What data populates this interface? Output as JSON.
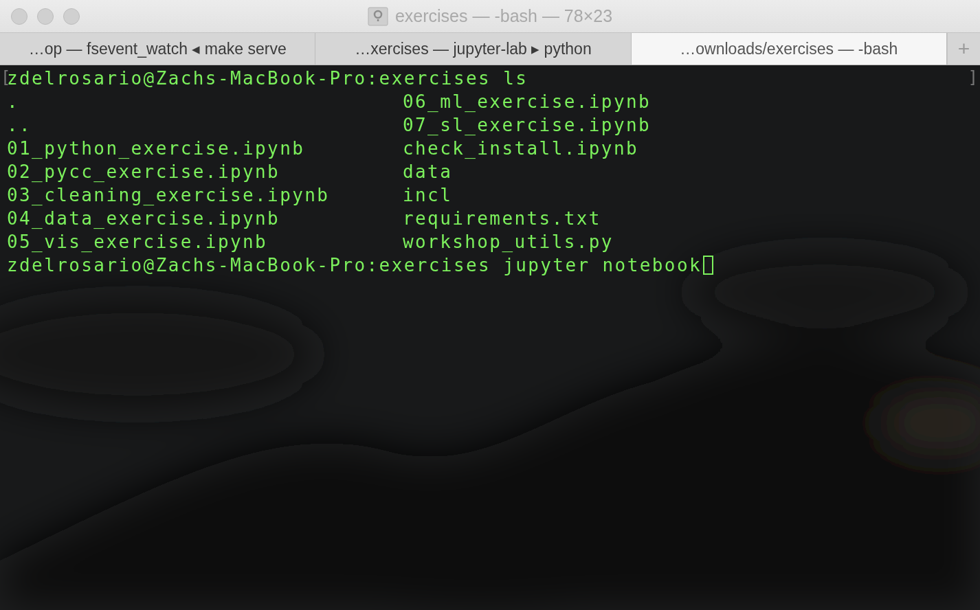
{
  "window": {
    "title": "exercises — -bash — 78×23"
  },
  "tabs": [
    {
      "label": "…op — fsevent_watch ◂ make serve",
      "selected": false
    },
    {
      "label": "…xercises — jupyter-lab ▸ python",
      "selected": false
    },
    {
      "label": "…ownloads/exercises — -bash",
      "selected": true
    }
  ],
  "new_tab_button": "+",
  "terminal": {
    "bracket_open": "[",
    "bracket_close": "]",
    "lines": [
      {
        "kind": "prompt",
        "prompt": "zdelrosario@Zachs-MacBook-Pro:exercises",
        "command": "ls",
        "cursor": false
      },
      {
        "kind": "listing",
        "column_1": ".",
        "column_2": "06_ml_exercise.ipynb"
      },
      {
        "kind": "listing",
        "column_1": "..",
        "column_2": "07_sl_exercise.ipynb"
      },
      {
        "kind": "listing",
        "column_1": "01_python_exercise.ipynb",
        "column_2": "check_install.ipynb"
      },
      {
        "kind": "listing",
        "column_1": "02_pycc_exercise.ipynb",
        "column_2": "data"
      },
      {
        "kind": "listing",
        "column_1": "03_cleaning_exercise.ipynb",
        "column_2": "incl"
      },
      {
        "kind": "listing",
        "column_1": "04_data_exercise.ipynb",
        "column_2": "requirements.txt"
      },
      {
        "kind": "listing",
        "column_1": "05_vis_exercise.ipynb",
        "column_2": "workshop_utils.py"
      },
      {
        "kind": "prompt",
        "prompt": "zdelrosario@Zachs-MacBook-Pro:exercises",
        "command": "jupyter notebook",
        "cursor": true
      }
    ]
  }
}
